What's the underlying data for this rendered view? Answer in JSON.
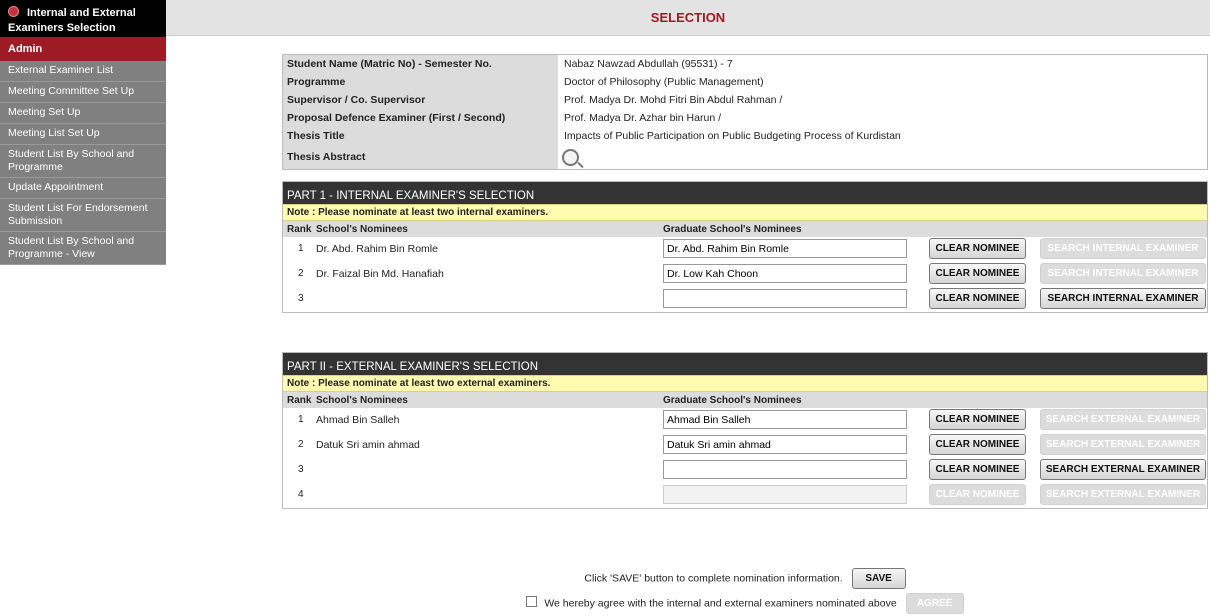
{
  "sidebar": {
    "header": "Internal and External Examiners Selection",
    "admin": "Admin",
    "items": [
      {
        "label": "External Examiner List",
        "lines": 1
      },
      {
        "label": "Meeting Committee Set Up",
        "lines": 1
      },
      {
        "label": "Meeting Set Up",
        "lines": 1
      },
      {
        "label": "Meeting List Set Up",
        "lines": 1
      },
      {
        "label": "Student List By School and Programme",
        "lines": 2
      },
      {
        "label": "Update Appointment",
        "lines": 1
      },
      {
        "label": "Student List For Endorsement Submission",
        "lines": 2
      },
      {
        "label": "Student List By School and Programme - View",
        "lines": 2
      }
    ]
  },
  "page": {
    "title": "SELECTION"
  },
  "info": {
    "student_label": "Student Name (Matric No) - Semester No.",
    "student_value": "Nabaz Nawzad Abdullah (95531)  - 7",
    "programme_label": "Programme",
    "programme_value": "Doctor of Philosophy (Public Management)",
    "supervisor_label": "Supervisor / Co. Supervisor",
    "supervisor_value": "Prof. Madya Dr. Mohd Fitri Bin Abdul Rahman /",
    "proposal_label": "Proposal Defence Examiner (First / Second)",
    "proposal_value": "Prof. Madya Dr. Azhar bin Harun /",
    "thesis_title_label": "Thesis Title",
    "thesis_title_value": "Impacts of Public Participation on Public Budgeting Process of Kurdistan",
    "thesis_abstract_label": "Thesis Abstract"
  },
  "part1": {
    "title": "PART 1 - INTERNAL EXAMINER'S SELECTION",
    "note": "Note : Please nominate at least two internal examiners.",
    "col_rank": "Rank",
    "col_school": "School's Nominees",
    "col_graduate": "Graduate School's Nominees",
    "clear_label": "CLEAR NOMINEE",
    "search_label": "SEARCH INTERNAL EXAMINER",
    "rows": [
      {
        "rank": "1",
        "nominee": "Dr. Abd. Rahim Bin Romle",
        "graduate": "Dr. Abd. Rahim Bin Romle"
      },
      {
        "rank": "2",
        "nominee": "Dr. Faizal Bin Md. Hanafiah",
        "graduate": "Dr. Low Kah Choon"
      },
      {
        "rank": "3",
        "nominee": "",
        "graduate": ""
      }
    ]
  },
  "part2": {
    "title": "PART II - EXTERNAL EXAMINER'S SELECTION",
    "note": "Note : Please nominate at least two external examiners.",
    "col_rank": "Rank",
    "col_school": "School's Nominees",
    "col_graduate": "Graduate School's Nominees",
    "clear_label": "CLEAR NOMINEE",
    "search_label": "SEARCH EXTERNAL EXAMINER",
    "rows": [
      {
        "rank": "1",
        "nominee": "Ahmad Bin Salleh",
        "graduate": "Ahmad Bin Salleh"
      },
      {
        "rank": "2",
        "nominee": "Datuk Sri amin ahmad",
        "graduate": "Datuk Sri amin ahmad"
      },
      {
        "rank": "3",
        "nominee": "",
        "graduate": ""
      },
      {
        "rank": "4",
        "nominee": "",
        "graduate": ""
      }
    ]
  },
  "footer": {
    "save_hint": "Click 'SAVE' button to complete nomination information.",
    "save_label": "SAVE",
    "agree_text": "We hereby agree with the internal and external examiners nominated above",
    "agree_label": "AGREE"
  }
}
